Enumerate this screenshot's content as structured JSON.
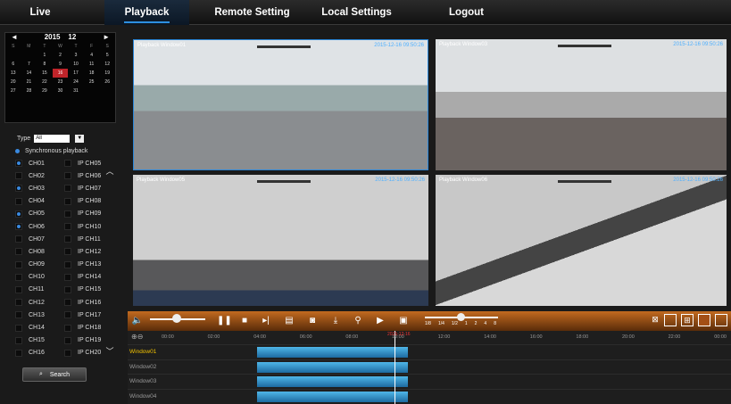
{
  "nav": {
    "tabs": [
      {
        "label": "Live"
      },
      {
        "label": "Playback",
        "active": true
      },
      {
        "label": "Remote Setting"
      },
      {
        "label": "Local Settings"
      },
      {
        "label": "Logout"
      }
    ]
  },
  "calendar": {
    "prev": "◄",
    "year": "2015",
    "month": "12",
    "next": "►",
    "days_of_week": [
      "S",
      "M",
      "T",
      "W",
      "T",
      "F",
      "S"
    ],
    "weeks": [
      [
        "",
        "",
        "1",
        "2",
        "3",
        "4",
        "5"
      ],
      [
        "6",
        "7",
        "8",
        "9",
        "10",
        "11",
        "12"
      ],
      [
        "13",
        "14",
        "15",
        "16",
        "17",
        "18",
        "19"
      ],
      [
        "20",
        "21",
        "22",
        "23",
        "24",
        "25",
        "26"
      ],
      [
        "27",
        "28",
        "29",
        "30",
        "31",
        "",
        ""
      ]
    ],
    "selected_day": "16"
  },
  "filter": {
    "type_label": "Type",
    "type_value": "All"
  },
  "sync": {
    "label": "Synchronous playback"
  },
  "channels": [
    {
      "ch": "CH01",
      "ip": "IP CH05",
      "ch_on": true
    },
    {
      "ch": "CH02",
      "ip": "IP CH06",
      "ch_on": false
    },
    {
      "ch": "CH03",
      "ip": "IP CH07",
      "ch_on": true
    },
    {
      "ch": "CH04",
      "ip": "IP CH08",
      "ch_on": false
    },
    {
      "ch": "CH05",
      "ip": "IP CH09",
      "ch_on": true
    },
    {
      "ch": "CH06",
      "ip": "IP CH10",
      "ch_on": true
    },
    {
      "ch": "CH07",
      "ip": "IP CH11",
      "ch_on": false
    },
    {
      "ch": "CH08",
      "ip": "IP CH12",
      "ch_on": false
    },
    {
      "ch": "CH09",
      "ip": "IP CH13",
      "ch_on": false
    },
    {
      "ch": "CH10",
      "ip": "IP CH14",
      "ch_on": false
    },
    {
      "ch": "CH11",
      "ip": "IP CH15",
      "ch_on": false
    },
    {
      "ch": "CH12",
      "ip": "IP CH16",
      "ch_on": false
    },
    {
      "ch": "CH13",
      "ip": "IP CH17",
      "ch_on": false
    },
    {
      "ch": "CH14",
      "ip": "IP CH18",
      "ch_on": false
    },
    {
      "ch": "CH15",
      "ip": "IP CH19",
      "ch_on": false
    },
    {
      "ch": "CH16",
      "ip": "IP CH20",
      "ch_on": false
    }
  ],
  "search": {
    "label": "Search"
  },
  "windows": [
    {
      "title": "Playback Window01",
      "timestamp": "2015-12-16 09:50:26"
    },
    {
      "title": "Playback Window03",
      "timestamp": "2015-12-16 09:50:26"
    },
    {
      "title": "Playback Window05",
      "timestamp": "2015-12-16 09:50:26"
    },
    {
      "title": "Playback Window06",
      "timestamp": "2015-12-16 09:50:26"
    }
  ],
  "speed": {
    "ticks": [
      "1/8",
      "1/4",
      "1/2",
      "1",
      "2",
      "4",
      "8"
    ]
  },
  "timeline": {
    "hours": [
      "00:00",
      "02:00",
      "04:00",
      "06:00",
      "08:00",
      "10:00",
      "12:00",
      "14:00",
      "16:00",
      "18:00",
      "20:00",
      "22:00",
      "00:00"
    ],
    "rows": [
      {
        "label": "Window01",
        "active": true
      },
      {
        "label": "Window02"
      },
      {
        "label": "Window03"
      },
      {
        "label": "Window04"
      }
    ],
    "cursor_date": "2015-12-16"
  },
  "icons": {
    "volume": "speaker-icon",
    "pause": "pause-icon",
    "stop": "stop-icon",
    "step": "step-forward-icon",
    "clip": "clip-icon",
    "snapshot": "camera-icon",
    "download": "download-icon",
    "zoom": "magnifier-icon",
    "play": "play-icon",
    "record": "record-icon"
  },
  "colors": {
    "accent": "#2d8fe0",
    "toolbar": "#c36a20",
    "selected_day": "#c0242a",
    "timestamp": "#4fb0ff"
  }
}
